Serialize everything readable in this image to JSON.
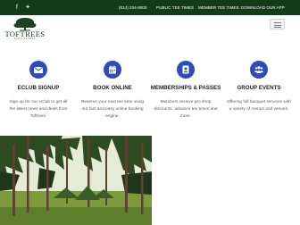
{
  "topbar": {
    "social": [
      "facebook-icon",
      "twitter-icon"
    ],
    "phone": "(814) 234-8000",
    "links": [
      "PUBLIC TEE TIMES",
      "MEMBER TEE TIMES",
      "DOWNLOAD OUR APP"
    ],
    "background": "#123b1a"
  },
  "brand": {
    "name": "TOFTREES",
    "tagline": "GOLF RESORT"
  },
  "header": {
    "menu_icon": "hamburger-icon"
  },
  "accent_color": "#2f4bb7",
  "features": [
    {
      "icon": "email-icon",
      "title": "ECLUB SIGNUP",
      "desc": "Sign up for our eClub to get all the latest news and deals from Toftrees."
    },
    {
      "icon": "calendar-icon",
      "title": "BOOK ONLINE",
      "desc": "Reserve your next tee time using our fast and easy online booking engine."
    },
    {
      "icon": "id-card-icon",
      "title": "MEMBERSHIPS & PASSES",
      "desc": "Members receive pro shop discounts, advance tee times and more."
    },
    {
      "icon": "group-icon",
      "title": "GROUP EVENTS",
      "desc": "Offering full banquet services with a variety of menus and venues."
    }
  ],
  "hero_image": "pine-forest-photo"
}
